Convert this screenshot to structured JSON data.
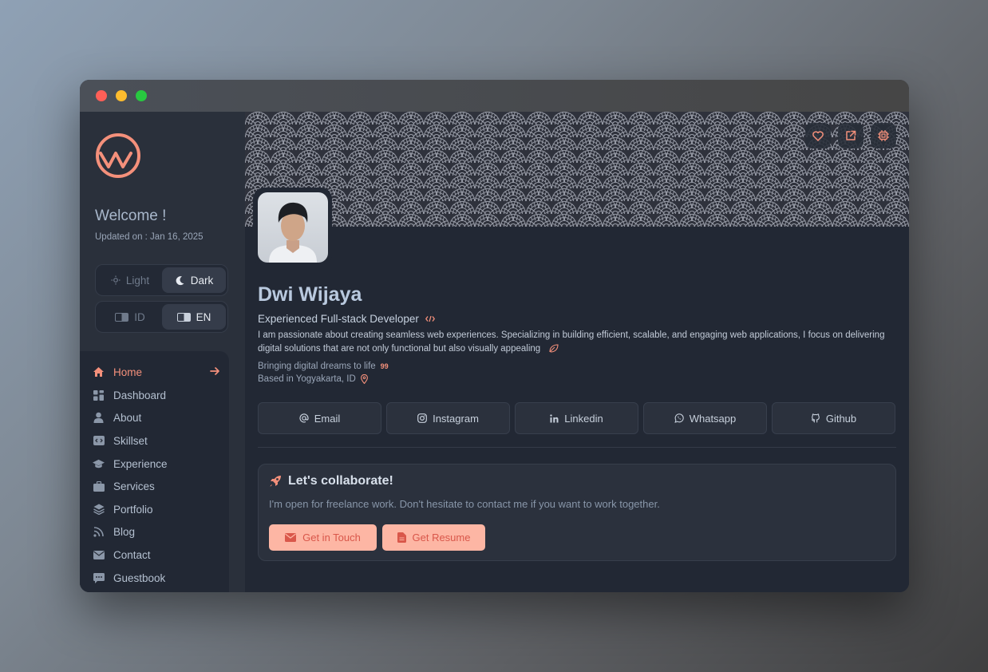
{
  "window": {
    "controls": [
      "close",
      "minimize",
      "maximize"
    ]
  },
  "sidebar": {
    "welcome": "Welcome !",
    "updated": "Updated on : Jan 16, 2025",
    "theme": {
      "light": "Light",
      "dark": "Dark",
      "active": "Dark"
    },
    "language": {
      "id": "ID",
      "en": "EN",
      "active": "EN"
    },
    "nav": [
      {
        "label": "Home",
        "icon": "home-icon",
        "active": true
      },
      {
        "label": "Dashboard",
        "icon": "dashboard-icon",
        "active": false
      },
      {
        "label": "About",
        "icon": "user-icon",
        "active": false
      },
      {
        "label": "Skillset",
        "icon": "code-icon",
        "active": false
      },
      {
        "label": "Experience",
        "icon": "graduation-cap-icon",
        "active": false
      },
      {
        "label": "Services",
        "icon": "briefcase-icon",
        "active": false
      },
      {
        "label": "Portfolio",
        "icon": "layers-icon",
        "active": false
      },
      {
        "label": "Blog",
        "icon": "rss-icon",
        "active": false
      },
      {
        "label": "Contact",
        "icon": "envelope-icon",
        "active": false
      },
      {
        "label": "Guestbook",
        "icon": "chat-icon",
        "active": false
      }
    ]
  },
  "profile": {
    "name": "Dwi Wijaya",
    "role": "Experienced Full-stack Developer",
    "bio": "I am passionate about creating seamless web experiences. Specializing in building efficient, scalable, and engaging web applications, I focus on delivering digital solutions that are not only functional but also visually appealing",
    "tagline": "Bringing digital dreams to life",
    "tagline_mark": "99",
    "location": "Based in Yogyakarta, ID"
  },
  "socials": [
    {
      "label": "Email",
      "icon": "at-icon"
    },
    {
      "label": "Instagram",
      "icon": "instagram-icon"
    },
    {
      "label": "Linkedin",
      "icon": "linkedin-icon"
    },
    {
      "label": "Whatsapp",
      "icon": "whatsapp-icon"
    },
    {
      "label": "Github",
      "icon": "github-icon"
    }
  ],
  "collab": {
    "title": "Let's collaborate!",
    "description": "I'm open for freelance work. Don't hesitate to contact me if you want to work together.",
    "touch_label": "Get in Touch",
    "resume_label": "Get Resume"
  },
  "colors": {
    "accent": "#f4907b",
    "button_bg": "#fdb6a4",
    "button_text": "#d9574a",
    "background": "#222834",
    "sidebar": "#2a303b"
  }
}
